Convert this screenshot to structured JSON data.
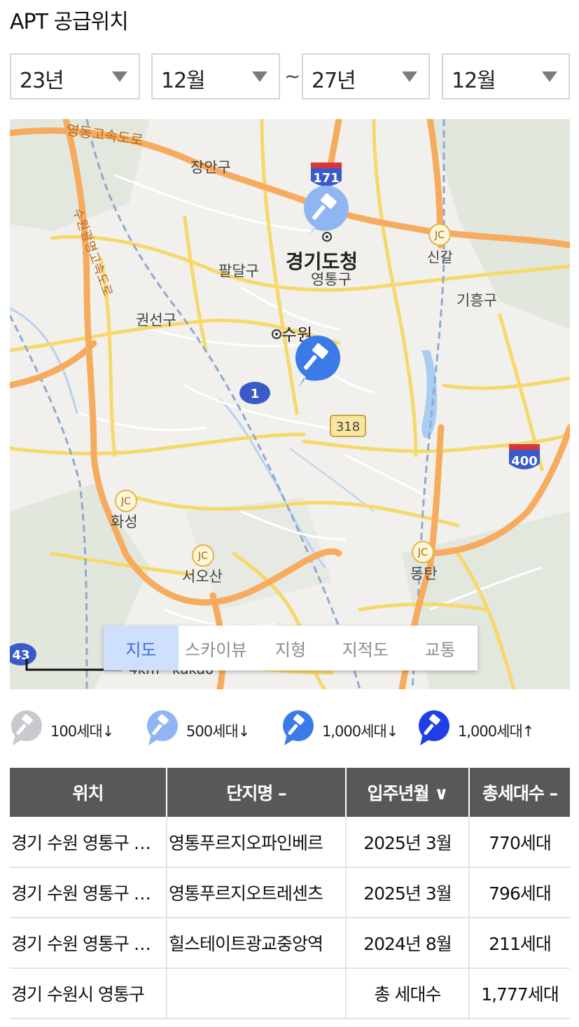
{
  "title": "APT 공급위치",
  "filters": {
    "start_year": "23년",
    "start_month": "12월",
    "separator": "~",
    "end_year": "27년",
    "end_month": "12월"
  },
  "map": {
    "labels": {
      "expressway": "영동고속도로",
      "jangan": "장안구",
      "suwon_expressway": "수원광명고속도로",
      "gyeonggi_office": "경기도청",
      "yeongtong": "영통구",
      "paldal": "팔달구",
      "gwonseon": "권선구",
      "singal": "신갈",
      "giheung": "기흥구",
      "suwon": "수원",
      "hwaseong": "화성",
      "seosan": "서오산",
      "dongtan": "동탄",
      "jc": "JC"
    },
    "route_badges": {
      "r171": "171",
      "r1": "1",
      "r318": "318",
      "r400": "400",
      "r43": "43"
    },
    "scale_text": "4km",
    "brand": "kakao",
    "tabs": [
      "지도",
      "스카이뷰",
      "지형",
      "지적도",
      "교통"
    ],
    "active_tab": "지도",
    "colors": {
      "pin_light": "#8fb6f3",
      "pin_mid": "#3b7be8",
      "pin_dark": "#1f3fe6",
      "pin_gray": "#c8c8cf"
    }
  },
  "legend": [
    {
      "label": "100세대↓",
      "color": "#c8c8cf"
    },
    {
      "label": "500세대↓",
      "color": "#8fb6f3"
    },
    {
      "label": "1,000세대↓",
      "color": "#3b7be8"
    },
    {
      "label": "1,000세대↑",
      "color": "#1f3fe6"
    }
  ],
  "table": {
    "headers": {
      "location": "위치",
      "complex": "단지명 –",
      "movein": "입주년월 ∨",
      "households": "총세대수 –"
    },
    "rows": [
      {
        "location": "경기 수원 영통구 이의동",
        "complex": "영통푸르지오파인베르",
        "movein": "2025년 3월",
        "households": "770세대"
      },
      {
        "location": "경기 수원 영통구 이의동",
        "complex": "영통푸르지오트레센츠",
        "movein": "2025년 3월",
        "households": "796세대"
      },
      {
        "location": "경기 수원 영통구 이의동",
        "complex": "힐스테이트광교중앙역",
        "movein": "2024년 8월",
        "households": "211세대"
      }
    ],
    "total": {
      "location": "경기 수원시 영통구",
      "label": "총 세대수",
      "households": "1,777세대"
    }
  }
}
